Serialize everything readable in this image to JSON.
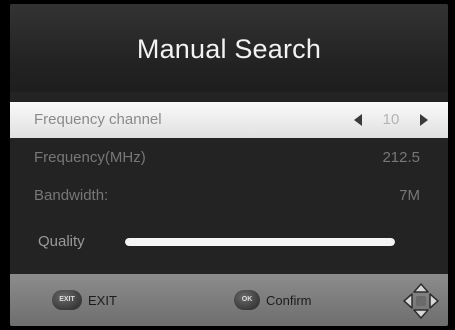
{
  "title": "Manual Search",
  "rows": [
    {
      "label": "Frequency channel",
      "value": "10",
      "selected": true
    },
    {
      "label": "Frequency(MHz)",
      "value": "212.5",
      "selected": false
    },
    {
      "label": "Bandwidth:",
      "value": "7M",
      "selected": false
    }
  ],
  "quality": {
    "label": "Quality",
    "level_percent": 100
  },
  "footer": {
    "exit_badge": "EXIT",
    "exit_label": "EXIT",
    "ok_badge": "OK",
    "confirm_label": "Confirm",
    "nav_icon": "dpad-icon"
  },
  "colors": {
    "background": "#232323",
    "selected_row": "#f0f0f0",
    "footer": "#7d7d7d",
    "quality_bar": "#f5f5f5"
  }
}
